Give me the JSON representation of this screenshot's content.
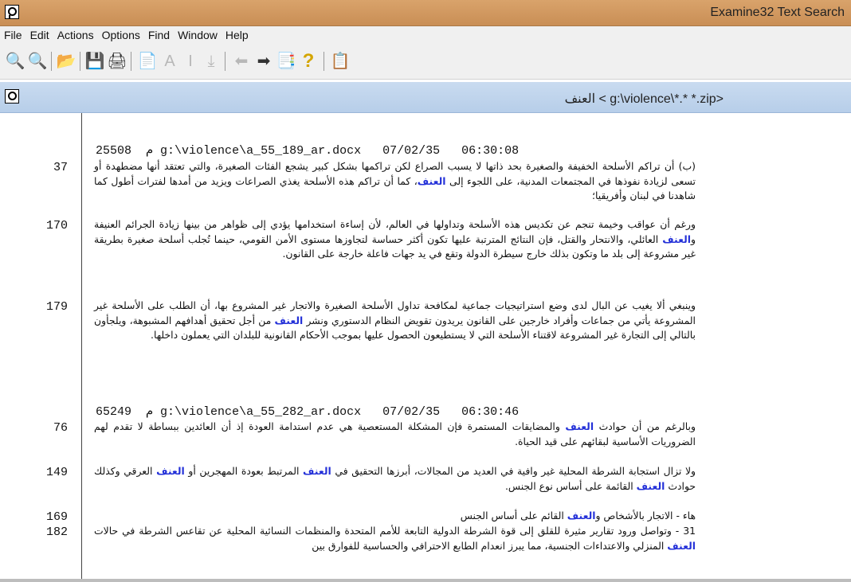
{
  "window": {
    "title": "Examine32 Text Search"
  },
  "menu": [
    "File",
    "Edit",
    "Actions",
    "Options",
    "Find",
    "Window",
    "Help"
  ],
  "toolbar": [
    {
      "icon": "zoom-out-icon",
      "glyph": "🔍"
    },
    {
      "icon": "zoom-in-icon",
      "glyph": "🔍"
    },
    {
      "icon": "open-folder-icon",
      "glyph": "📂"
    },
    {
      "icon": "save-icon",
      "glyph": "💾"
    },
    {
      "icon": "print-icon",
      "glyph": "🖨"
    },
    {
      "icon": "page-icon",
      "glyph": "📄"
    },
    {
      "icon": "font-increase-icon",
      "glyph": "A"
    },
    {
      "icon": "text-cursor-icon",
      "glyph": "I"
    },
    {
      "icon": "download-icon",
      "glyph": "⤓"
    },
    {
      "icon": "arrow-left-icon",
      "glyph": "⬅"
    },
    {
      "icon": "arrow-right-icon",
      "glyph": "➡"
    },
    {
      "icon": "copy-icon",
      "glyph": "📑"
    },
    {
      "icon": "help-icon",
      "glyph": "?"
    },
    {
      "icon": "clipboard-icon",
      "glyph": "📋"
    }
  ],
  "document": {
    "title": "العنف < g:\\violence\\*.* *.zip>"
  },
  "results": [
    {
      "header": "25508  م g:\\violence\\a_55_189_ar.docx   07/02/35   06:30:08",
      "paragraphs": [
        {
          "line": "37",
          "segments": [
            {
              "t": "(ب) أن تراكم الأسلحة الخفيفة والصغيرة بحد ذاتها لا يسبب الصراع لكن تراكمها بشكل كبير يشجع الفئات الصغيرة، والتي تعتقد أنها مضطهدة أو تسعى لزيادة نفوذها في المجتمعات المدنية، على اللجوء إلى "
            },
            {
              "t": "العنف",
              "hl": true
            },
            {
              "t": "، كما أن تراكم هذه الأسلحة يغذي الصراعات ويزيد من أمدها لفترات أطول كما شاهدنا في لبنان وأفريقيا؛"
            }
          ]
        },
        {
          "line": "170",
          "segments": [
            {
              "t": "ورغم أن عواقب وخيمة تنجم عن تكديس هذه الأسلحة وتداولها في العالم، لأن إساءة استخدامها يؤدي إلى ظواهر من بينها زيادة الجرائم العنيفة و"
            },
            {
              "t": "العنف",
              "hl": true
            },
            {
              "t": " العائلي، والانتحار والقتل، فإن النتائج المترتبة عليها تكون أكثر حساسة لتجاوزها مستوى الأمن القومي، حينما تُجلب أسلحة صغيرة بطريقة غير مشروعة إلى بلد ما وتكون بذلك خارج سيطرة الدولة وتقع في يد جهات فاعلة خارجة على القانون."
            }
          ]
        },
        {
          "line": "179",
          "segments": [
            {
              "t": "وينبغي ألا يغيب عن البال لدى وضع استراتيجيات جماعية لمكافحة تداول الأسلحة الصغيرة والاتجار غير المشروع بها، أن الطلب على الأسلحة غير المشروعة يأتي من جماعات وأفراد خارجين على القانون يريدون تقويض النظام الدستوري ونشر "
            },
            {
              "t": "العنف",
              "hl": true
            },
            {
              "t": " من أجل تحقيق أهدافهم المشبوهة، ويلجأون بالتالي إلى التجارة غير المشروعة لاقتناء الأسلحة التي لا يستطيعون الحصول عليها بموجب الأحكام القانونية للبلدان التي يعملون داخلها."
            }
          ]
        }
      ]
    },
    {
      "header": "65249  م g:\\violence\\a_55_282_ar.docx   07/02/35   06:30:46",
      "paragraphs": [
        {
          "line": "76",
          "segments": [
            {
              "t": "وبالرغم من أن حوادث "
            },
            {
              "t": "العنف",
              "hl": true
            },
            {
              "t": " والمضايقات المستمرة فإن المشكلة المستعصية هي عدم استدامة العودة إذ أن العائدين ببساطة لا تقدم لهم الضروريات الأساسية لبقائهم على قيد الحياة."
            }
          ]
        },
        {
          "line": "149",
          "segments": [
            {
              "t": "ولا تزال استجابة الشرطة المحلية غير وافية في العديد من المجالات، أبرزها التحقيق في "
            },
            {
              "t": "العنف",
              "hl": true
            },
            {
              "t": " المرتبط بعودة المهجرين أو "
            },
            {
              "t": "العنف",
              "hl": true
            },
            {
              "t": " العرقي وكذلك حوادث "
            },
            {
              "t": "العنف",
              "hl": true
            },
            {
              "t": " القائمة على أساس نوع الجنس."
            }
          ]
        },
        {
          "line": "169",
          "segments": [
            {
              "t": "هاء - الاتجار بالأشخاص و"
            },
            {
              "t": "العنف",
              "hl": true
            },
            {
              "t": " القائم على أساس الجنس"
            }
          ]
        },
        {
          "line": "182",
          "segments": [
            {
              "t": "31 - وتواصل ورود تقارير مثيرة للقلق إلى قوة الشرطة الدولية التابعة للأمم المتحدة والمنظمات النسائية المحلية عن تقاعس الشرطة في حالات "
            },
            {
              "t": "العنف",
              "hl": true
            },
            {
              "t": " المنزلي والاعتداءات الجنسية، مما يبرز انعدام الطابع الاحترافي والحساسية للفوارق بين"
            }
          ]
        }
      ]
    }
  ]
}
